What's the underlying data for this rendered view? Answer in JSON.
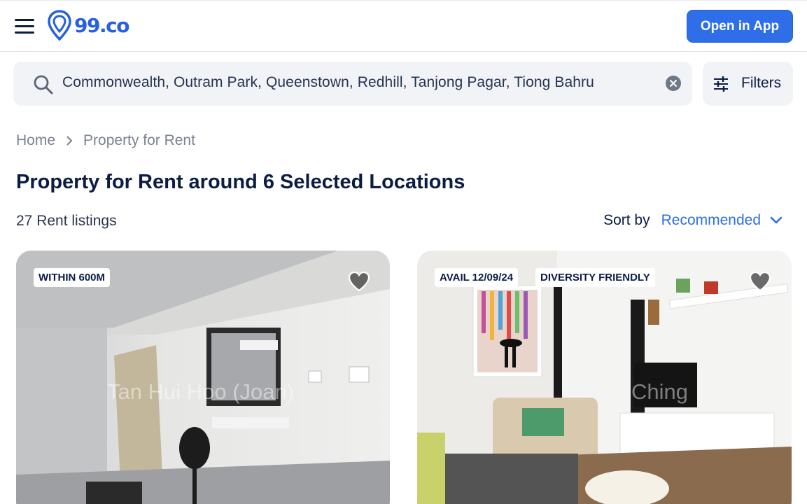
{
  "header": {
    "logo_text": "99.co",
    "open_app_label": "Open in App"
  },
  "search": {
    "value": "Commonwealth, Outram Park, Queenstown, Redhill, Tanjong Pagar, Tiong Bahru",
    "filters_label": "Filters"
  },
  "breadcrumb": {
    "items": [
      "Home",
      "Property for Rent"
    ]
  },
  "page_title": "Property for Rent around 6 Selected Locations",
  "listings_count": "27 Rent listings",
  "sort": {
    "label": "Sort by",
    "value": "Recommended"
  },
  "cards": [
    {
      "badges": [
        "WITHIN 600M"
      ],
      "watermark": "Tan Hui Hoo (Joan)"
    },
    {
      "badges": [
        "AVAIL 12/09/24",
        "DIVERSITY FRIENDLY"
      ],
      "watermark": "Ching"
    }
  ],
  "colors": {
    "brand": "#2e6ee8",
    "text_dark": "#0b1c45",
    "muted": "#7a8191"
  }
}
